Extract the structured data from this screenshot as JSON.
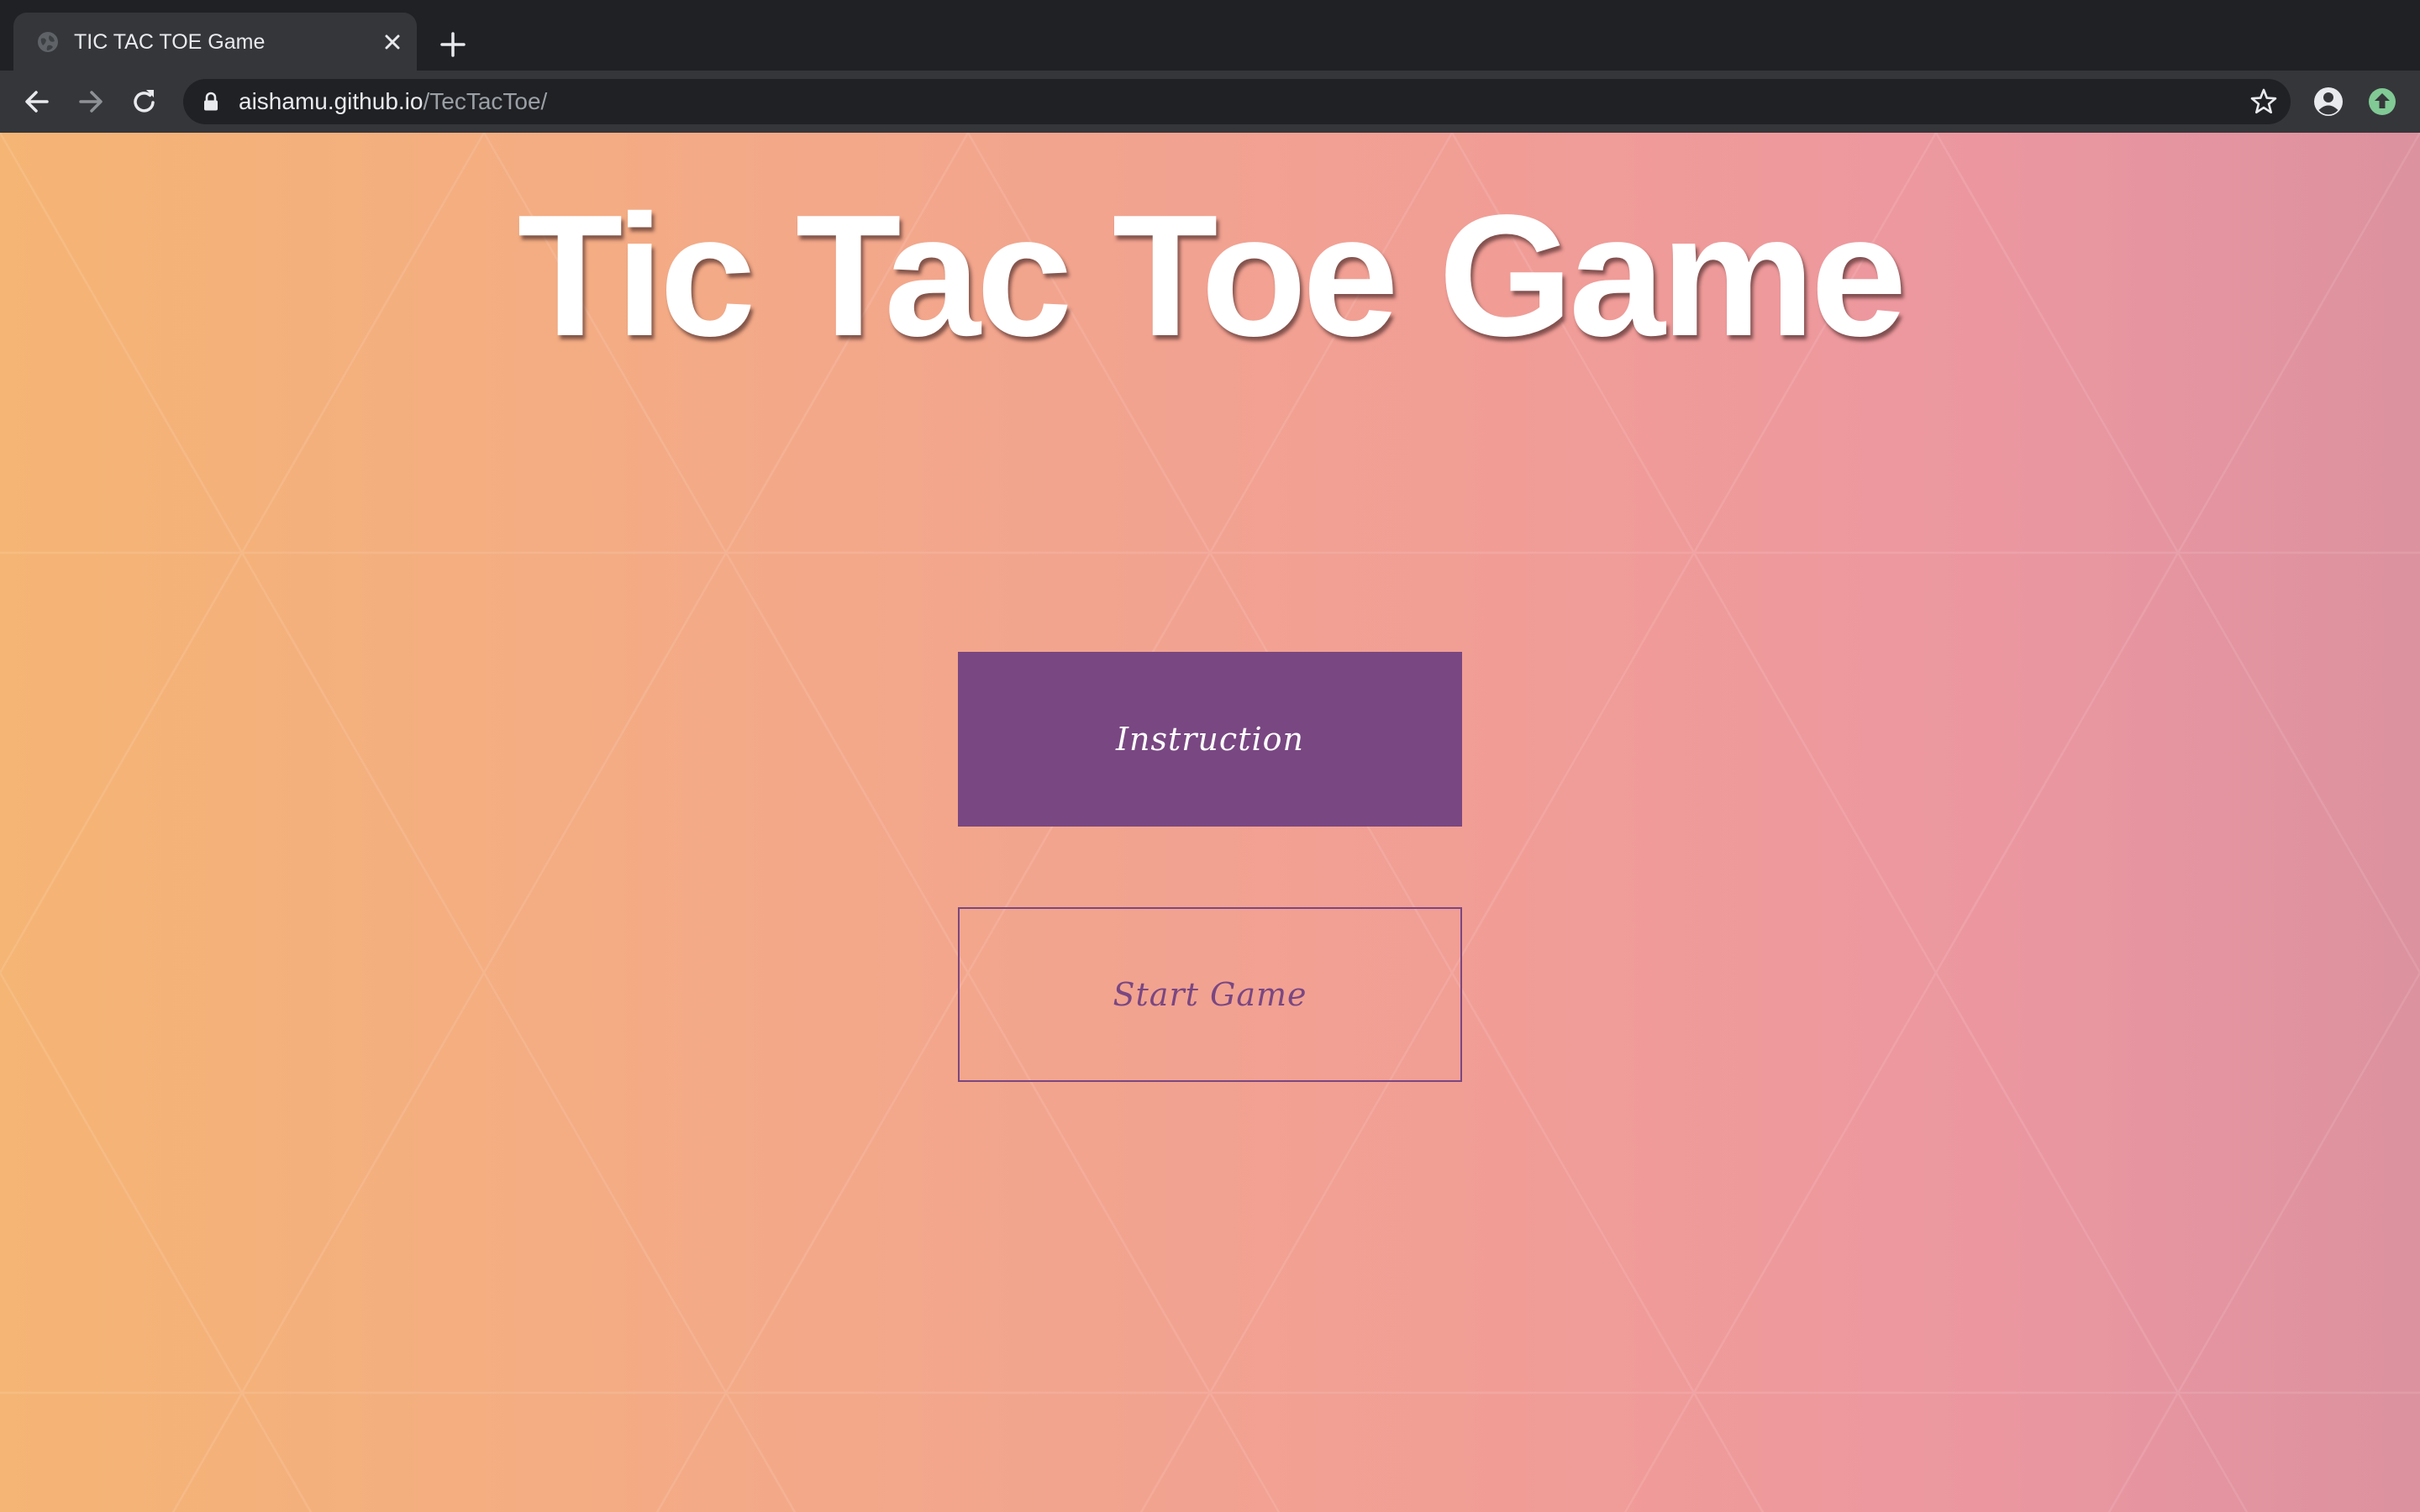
{
  "browser": {
    "tab_title": "TIC TAC TOE Game",
    "url_host": "aishamu.github.io",
    "url_path": "/TecTacToe/"
  },
  "page": {
    "title": "Tic Tac Toe Game",
    "buttons": {
      "instruction": "Instruction",
      "start_game": "Start Game"
    }
  },
  "colors": {
    "accent_purple": "#794782",
    "gradient_start": "#f5b574",
    "gradient_end": "#dc929f"
  },
  "icons": {
    "tab_favicon": "globe-icon",
    "tab_close": "close-icon",
    "new_tab": "plus-icon",
    "back": "arrow-left-icon",
    "forward": "arrow-right-icon",
    "reload": "reload-icon",
    "lock": "lock-icon",
    "bookmark": "star-icon",
    "profile": "account-circle-icon",
    "update": "update-arrow-icon"
  }
}
